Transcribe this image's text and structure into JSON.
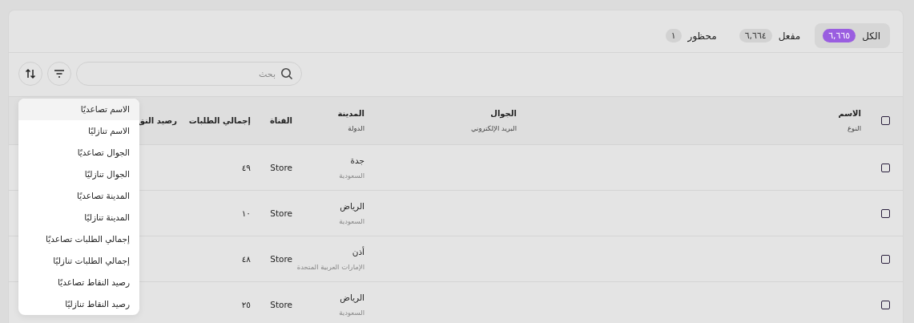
{
  "tabs": [
    {
      "label": "الكل",
      "count": "٦,٦٦٥",
      "selected": true
    },
    {
      "label": "مفعل",
      "count": "٦,٦٦٤",
      "selected": false
    },
    {
      "label": "محظور",
      "count": "١",
      "selected": false
    }
  ],
  "search": {
    "placeholder": "بحث"
  },
  "table": {
    "select_all": {
      "checked": false
    },
    "columns": [
      {
        "title": "الاسم",
        "subtitle": "النوع"
      },
      {
        "title": "الجوال",
        "subtitle": "البريد الإلكتروني"
      },
      {
        "title": "المدينة",
        "subtitle": "الدولة"
      },
      {
        "title": "القناة"
      },
      {
        "title": "إجمالي الطلبات"
      },
      {
        "title": "رصيد النق"
      }
    ],
    "rows": [
      {
        "checked": false,
        "city": "جدة",
        "country": "السعودية",
        "channel": "Store",
        "orders": "٤٩"
      },
      {
        "checked": false,
        "city": "الرياض",
        "country": "السعودية",
        "channel": "Store",
        "orders": "١٠"
      },
      {
        "checked": false,
        "city": "أذن",
        "country": "الإمارات العربية المتحدة",
        "channel": "Store",
        "orders": "٤٨"
      },
      {
        "checked": false,
        "city": "الرياض",
        "country": "السعودية",
        "channel": "Store",
        "orders": "٢٥"
      }
    ]
  },
  "sort_menu": {
    "items": [
      {
        "label": "الاسم تصاعديًا",
        "highlighted": true
      },
      {
        "label": "الاسم تنازليًا",
        "highlighted": false
      },
      {
        "label": "الجوال تصاعديًا",
        "highlighted": false
      },
      {
        "label": "الجوال تنازليًا",
        "highlighted": false
      },
      {
        "label": "المدينة تصاعديًا",
        "highlighted": false
      },
      {
        "label": "المدينة تنازليًا",
        "highlighted": false
      },
      {
        "label": "إجمالي الطلبات تصاعديًا",
        "highlighted": false
      },
      {
        "label": "إجمالي الطلبات تنازليًا",
        "highlighted": false
      },
      {
        "label": "رصيد النقاط تصاعديًا",
        "highlighted": false
      },
      {
        "label": "رصيد النقاط تنازليًا",
        "highlighted": false
      }
    ]
  }
}
